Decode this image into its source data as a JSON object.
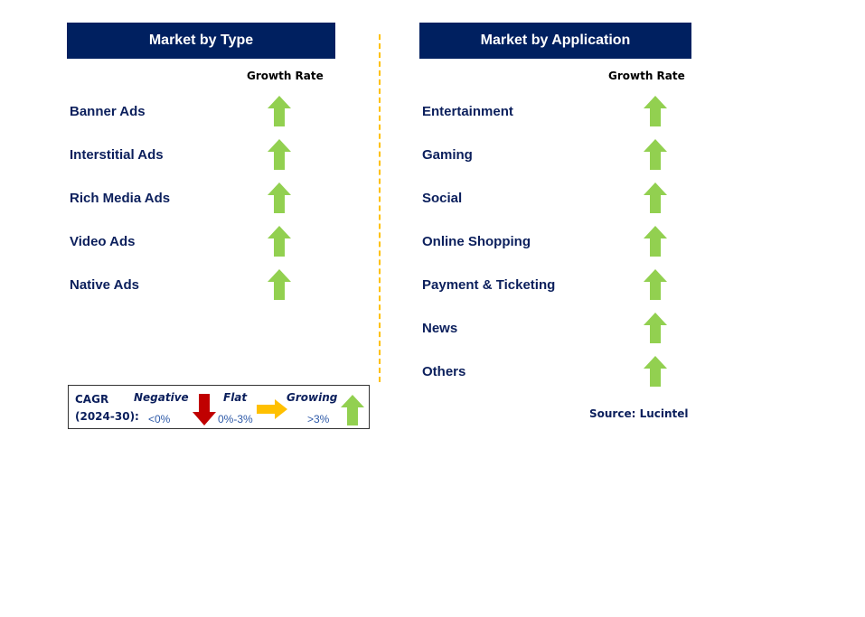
{
  "colors": {
    "header_bg": "#002060",
    "text": "#0b1f5c",
    "growing": "#92d050",
    "negative": "#c00000",
    "flat": "#ffc000",
    "divider": "#ffc000"
  },
  "type_panel": {
    "title": "Market by Type",
    "growth_header": "Growth Rate",
    "items": [
      {
        "label": "Banner Ads",
        "trend": "growing"
      },
      {
        "label": "Interstitial Ads",
        "trend": "growing"
      },
      {
        "label": "Rich Media Ads",
        "trend": "growing"
      },
      {
        "label": "Video Ads",
        "trend": "growing"
      },
      {
        "label": "Native Ads",
        "trend": "growing"
      }
    ]
  },
  "application_panel": {
    "title": "Market by Application",
    "growth_header": "Growth Rate",
    "items": [
      {
        "label": "Entertainment",
        "trend": "growing"
      },
      {
        "label": "Gaming",
        "trend": "growing"
      },
      {
        "label": "Social",
        "trend": "growing"
      },
      {
        "label": "Online Shopping",
        "trend": "growing"
      },
      {
        "label": "Payment & Ticketing",
        "trend": "growing"
      },
      {
        "label": "News",
        "trend": "growing"
      },
      {
        "label": "Others",
        "trend": "growing"
      }
    ]
  },
  "legend": {
    "cagr_label": "CAGR",
    "period_label": "(2024-30):",
    "negative": {
      "label": "Negative",
      "range": "<0%",
      "icon": "down-arrow-icon"
    },
    "flat": {
      "label": "Flat",
      "range": "0%-3%",
      "icon": "right-arrow-icon"
    },
    "growing": {
      "label": "Growing",
      "range": ">3%",
      "icon": "up-arrow-icon"
    }
  },
  "source": "Source: Lucintel"
}
